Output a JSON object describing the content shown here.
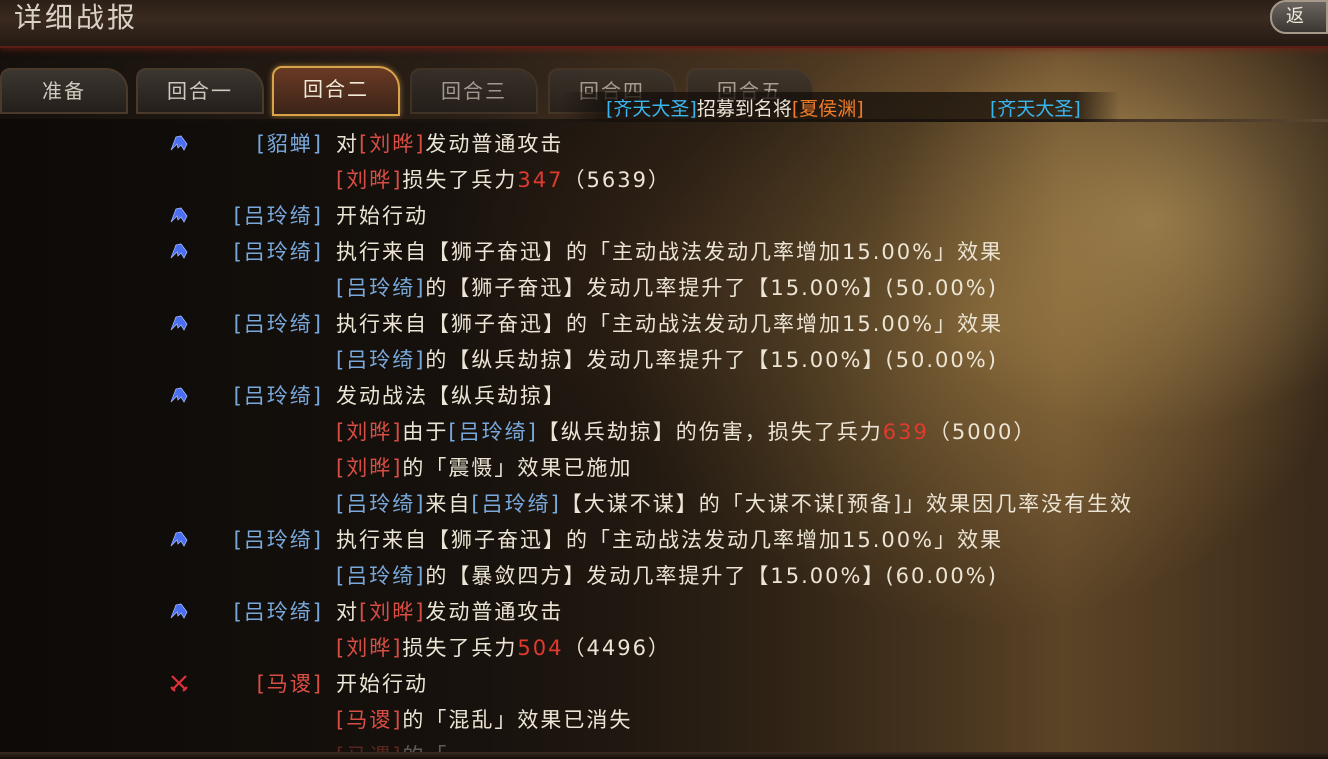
{
  "window": {
    "title": "详细战报",
    "close_glyph": "返"
  },
  "tabs": [
    {
      "label": "准备",
      "active": false
    },
    {
      "label": "回合一",
      "active": false
    },
    {
      "label": "回合二",
      "active": true
    },
    {
      "label": "回合三",
      "active": false
    },
    {
      "label": "回合四",
      "active": false
    },
    {
      "label": "回合五",
      "active": false
    }
  ],
  "broadcast": [
    {
      "segments": [
        {
          "text": "[齐天大圣]",
          "color": "cyan"
        },
        {
          "text": "招募到名将",
          "color": "white"
        },
        {
          "text": "[夏侯渊]",
          "color": "orange"
        }
      ]
    },
    {
      "segments": [
        {
          "text": "[齐天大圣]",
          "color": "cyan"
        }
      ]
    }
  ],
  "log": [
    {
      "icon": "attack-icon",
      "actor": "[貂蝉]",
      "actor_side": "ally",
      "segments": [
        {
          "text": "对",
          "color": "white"
        },
        {
          "text": "[刘晔]",
          "color": "red"
        },
        {
          "text": "发动普通攻击",
          "color": "white"
        }
      ]
    },
    {
      "icon": "",
      "actor": "",
      "segments": [
        {
          "text": "[刘晔]",
          "color": "red"
        },
        {
          "text": "损失了兵力",
          "color": "white"
        },
        {
          "text": "347",
          "color": "num"
        },
        {
          "text": "（5639）",
          "color": "white"
        }
      ]
    },
    {
      "icon": "attack-icon",
      "actor": "[吕玲绮]",
      "actor_side": "ally",
      "segments": [
        {
          "text": "开始行动",
          "color": "white"
        }
      ]
    },
    {
      "icon": "attack-icon",
      "actor": "[吕玲绮]",
      "actor_side": "ally",
      "segments": [
        {
          "text": "执行来自【狮子奋迅】的「主动战法发动几率增加15.00%」效果",
          "color": "white"
        }
      ]
    },
    {
      "icon": "",
      "actor": "",
      "segments": [
        {
          "text": "[吕玲绮]",
          "color": "blue"
        },
        {
          "text": "的【狮子奋迅】发动几率提升了【15.00%】(50.00%)",
          "color": "white"
        }
      ]
    },
    {
      "icon": "attack-icon",
      "actor": "[吕玲绮]",
      "actor_side": "ally",
      "segments": [
        {
          "text": "执行来自【狮子奋迅】的「主动战法发动几率增加15.00%」效果",
          "color": "white"
        }
      ]
    },
    {
      "icon": "",
      "actor": "",
      "segments": [
        {
          "text": "[吕玲绮]",
          "color": "blue"
        },
        {
          "text": "的【纵兵劫掠】发动几率提升了【15.00%】(50.00%)",
          "color": "white"
        }
      ]
    },
    {
      "icon": "attack-icon",
      "actor": "[吕玲绮]",
      "actor_side": "ally",
      "segments": [
        {
          "text": "发动战法【纵兵劫掠】",
          "color": "white"
        }
      ]
    },
    {
      "icon": "",
      "actor": "",
      "segments": [
        {
          "text": "[刘晔]",
          "color": "red"
        },
        {
          "text": "由于",
          "color": "white"
        },
        {
          "text": "[吕玲绮]",
          "color": "blue"
        },
        {
          "text": "【纵兵劫掠】的伤害，损失了兵力",
          "color": "white"
        },
        {
          "text": "639",
          "color": "num"
        },
        {
          "text": "（5000）",
          "color": "white"
        }
      ]
    },
    {
      "icon": "",
      "actor": "",
      "segments": [
        {
          "text": "[刘晔]",
          "color": "red"
        },
        {
          "text": "的「震慑」效果已施加",
          "color": "white"
        }
      ]
    },
    {
      "icon": "",
      "actor": "",
      "segments": [
        {
          "text": "[吕玲绮]",
          "color": "blue"
        },
        {
          "text": "来自",
          "color": "white"
        },
        {
          "text": "[吕玲绮]",
          "color": "blue"
        },
        {
          "text": "【大谋不谋】的「大谋不谋[预备]」效果因几率没有生效",
          "color": "white"
        }
      ]
    },
    {
      "icon": "attack-icon",
      "actor": "[吕玲绮]",
      "actor_side": "ally",
      "segments": [
        {
          "text": "执行来自【狮子奋迅】的「主动战法发动几率增加15.00%」效果",
          "color": "white"
        }
      ]
    },
    {
      "icon": "",
      "actor": "",
      "segments": [
        {
          "text": "[吕玲绮]",
          "color": "blue"
        },
        {
          "text": "的【暴敛四方】发动几率提升了【15.00%】(60.00%)",
          "color": "white"
        }
      ]
    },
    {
      "icon": "attack-icon",
      "actor": "[吕玲绮]",
      "actor_side": "ally",
      "segments": [
        {
          "text": "对",
          "color": "white"
        },
        {
          "text": "[刘晔]",
          "color": "red"
        },
        {
          "text": "发动普通攻击",
          "color": "white"
        }
      ]
    },
    {
      "icon": "",
      "actor": "",
      "segments": [
        {
          "text": "[刘晔]",
          "color": "red"
        },
        {
          "text": "损失了兵力",
          "color": "white"
        },
        {
          "text": "504",
          "color": "num"
        },
        {
          "text": "（4496）",
          "color": "white"
        }
      ]
    },
    {
      "icon": "crossed-swords-icon",
      "actor": "[马谡]",
      "actor_side": "enemy",
      "segments": [
        {
          "text": "开始行动",
          "color": "white"
        }
      ]
    },
    {
      "icon": "",
      "actor": "",
      "segments": [
        {
          "text": "[马谡]",
          "color": "red"
        },
        {
          "text": "的「混乱」效果已消失",
          "color": "white"
        }
      ]
    },
    {
      "icon": "",
      "actor": "",
      "faded": true,
      "segments": [
        {
          "text": "[马谡]",
          "color": "red"
        },
        {
          "text": "的「",
          "color": "white"
        }
      ]
    }
  ],
  "colors": {
    "blue": "#79a8dc",
    "red": "#d84d44",
    "num": "#e03a2e",
    "white": "#ece4d4",
    "cyan": "#38b6ee",
    "orange": "#f07c2a",
    "tab_active_border": "#d9a34a"
  }
}
